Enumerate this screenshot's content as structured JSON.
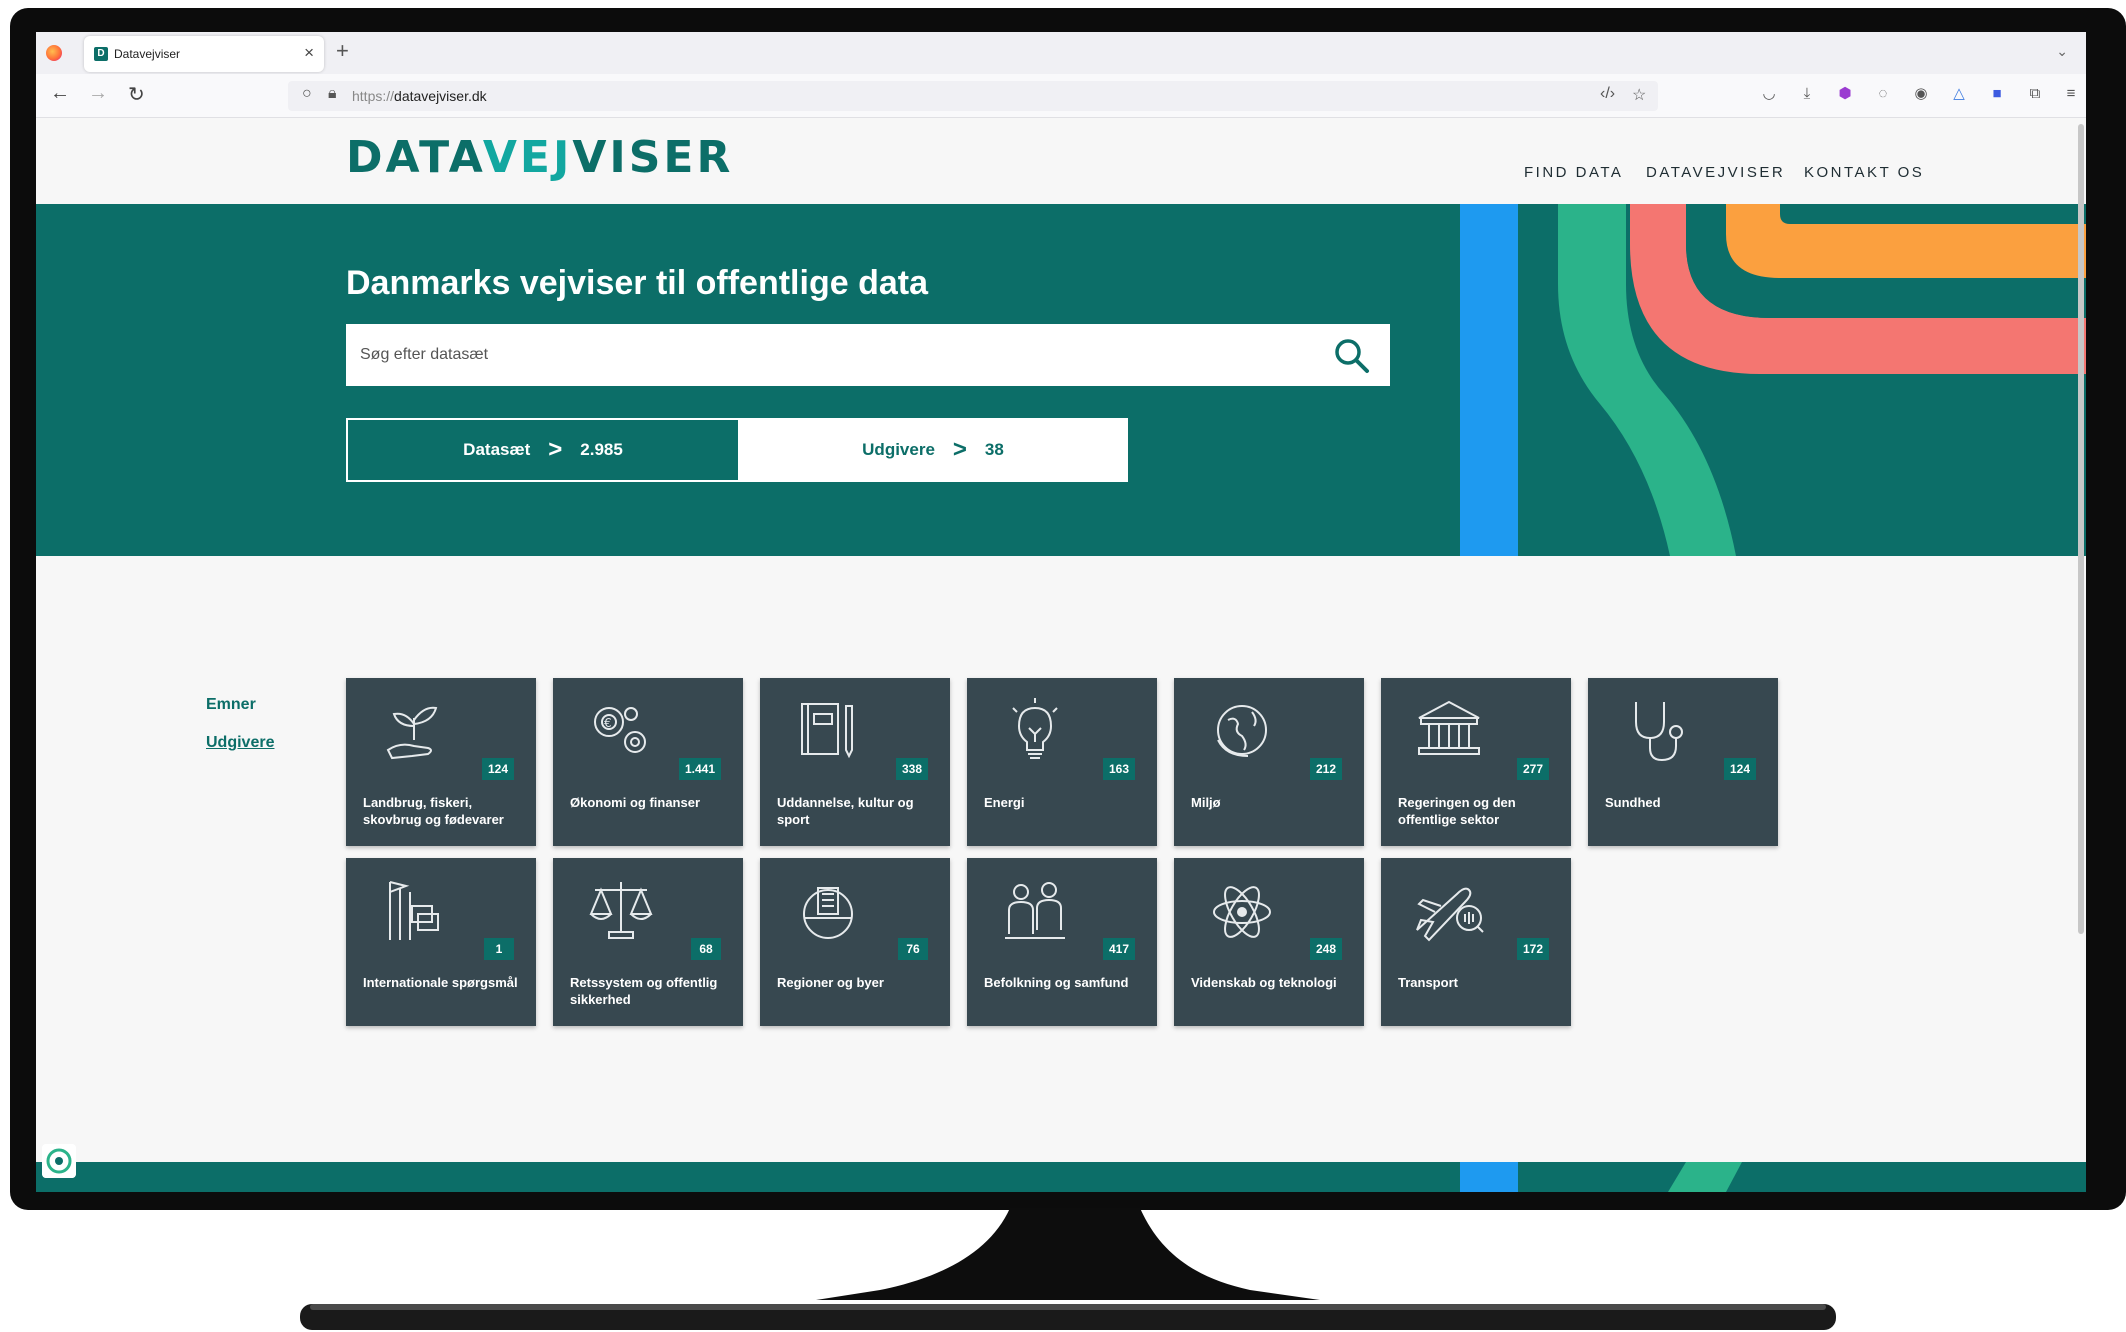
{
  "browser": {
    "tab_title": "Datavejviser",
    "tab_favicon_letter": "D",
    "tab_close": "×",
    "new_tab": "+",
    "url_scheme": "https://",
    "url_host": "datavejviser.dk"
  },
  "site": {
    "logo": "DATAVEJVISER",
    "nav": [
      "FIND DATA",
      "DATAVEJVISER",
      "KONTAKT OS"
    ]
  },
  "hero": {
    "title": "Danmarks vejviser til offentlige data",
    "search_placeholder": "Søg efter datasæt",
    "toggle": [
      {
        "label": "Datasæt",
        "chevron": ">",
        "count": "2.985"
      },
      {
        "label": "Udgivere",
        "chevron": ">",
        "count": "38"
      }
    ]
  },
  "sidebar": {
    "links": [
      "Emner",
      "Udgivere"
    ]
  },
  "topics": [
    {
      "label": "Landbrug, fiskeri, skovbrug og fødevarer",
      "count": "124",
      "icon": "plant-hand-icon"
    },
    {
      "label": "Økonomi og finanser",
      "count": "1.441",
      "icon": "gears-euro-icon"
    },
    {
      "label": "Uddannelse, kultur og sport",
      "count": "338",
      "icon": "book-pencil-icon"
    },
    {
      "label": "Energi",
      "count": "163",
      "icon": "lightbulb-icon"
    },
    {
      "label": "Miljø",
      "count": "212",
      "icon": "globe-icon"
    },
    {
      "label": "Regeringen og den offentlige sektor",
      "count": "277",
      "icon": "government-building-icon"
    },
    {
      "label": "Sundhed",
      "count": "124",
      "icon": "stethoscope-icon"
    },
    {
      "label": "Internationale spørgsmål",
      "count": "1",
      "icon": "flags-icon"
    },
    {
      "label": "Retssystem og offentlig sikkerhed",
      "count": "68",
      "icon": "scales-icon"
    },
    {
      "label": "Regioner og byer",
      "count": "76",
      "icon": "city-globe-icon"
    },
    {
      "label": "Befolkning og samfund",
      "count": "417",
      "icon": "people-icon"
    },
    {
      "label": "Videnskab og teknologi",
      "count": "248",
      "icon": "atom-icon"
    },
    {
      "label": "Transport",
      "count": "172",
      "icon": "airplane-icon"
    }
  ],
  "colors": {
    "brand_teal": "#0c6e68",
    "tile_bg": "#374850",
    "stripe_blue": "#1e9af0",
    "stripe_green": "#2bb38a",
    "stripe_red": "#f47671",
    "stripe_orange": "#fba03f"
  }
}
